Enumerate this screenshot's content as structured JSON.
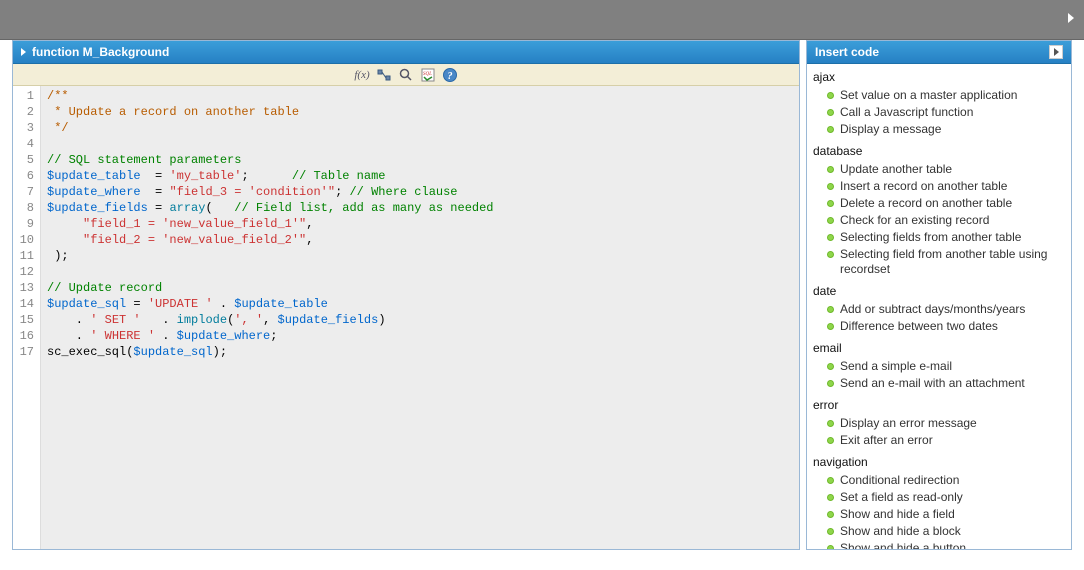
{
  "left_header": {
    "title": "function M_Background"
  },
  "right_header": {
    "title": "Insert code"
  },
  "toolbar_icons": [
    "fx-icon",
    "match-brackets-icon",
    "search-icon",
    "sql-icon",
    "help-icon"
  ],
  "code": {
    "lines": [
      [
        [
          "doccomment",
          "/**"
        ]
      ],
      [
        [
          "doccomment",
          " * Update a record on another table"
        ]
      ],
      [
        [
          "doccomment",
          " */"
        ]
      ],
      [],
      [
        [
          "comment",
          "// SQL statement parameters"
        ]
      ],
      [
        [
          "var",
          "$update_table"
        ],
        [
          "plain",
          "  = "
        ],
        [
          "str",
          "'my_table'"
        ],
        [
          "plain",
          ";      "
        ],
        [
          "comment",
          "// Table name"
        ]
      ],
      [
        [
          "var",
          "$update_where"
        ],
        [
          "plain",
          "  = "
        ],
        [
          "str",
          "\"field_3 = 'condition'\""
        ],
        [
          "plain",
          "; "
        ],
        [
          "comment",
          "// Where clause"
        ]
      ],
      [
        [
          "var",
          "$update_fields"
        ],
        [
          "plain",
          " = "
        ],
        [
          "kw",
          "array"
        ],
        [
          "plain",
          "(   "
        ],
        [
          "comment",
          "// Field list, add as many as needed"
        ]
      ],
      [
        [
          "plain",
          "     "
        ],
        [
          "str",
          "\"field_1 = 'new_value_field_1'\""
        ],
        [
          "plain",
          ","
        ]
      ],
      [
        [
          "plain",
          "     "
        ],
        [
          "str",
          "\"field_2 = 'new_value_field_2'\""
        ],
        [
          "plain",
          ","
        ]
      ],
      [
        [
          "plain",
          " );"
        ]
      ],
      [],
      [
        [
          "comment",
          "// Update record"
        ]
      ],
      [
        [
          "var",
          "$update_sql"
        ],
        [
          "plain",
          " = "
        ],
        [
          "str",
          "'UPDATE '"
        ],
        [
          "plain",
          " . "
        ],
        [
          "var",
          "$update_table"
        ]
      ],
      [
        [
          "plain",
          "    . "
        ],
        [
          "str",
          "' SET '"
        ],
        [
          "plain",
          "   . "
        ],
        [
          "kw",
          "implode"
        ],
        [
          "plain",
          "("
        ],
        [
          "str",
          "', '"
        ],
        [
          "plain",
          ", "
        ],
        [
          "var",
          "$update_fields"
        ],
        [
          "plain",
          ")"
        ]
      ],
      [
        [
          "plain",
          "    . "
        ],
        [
          "str",
          "' WHERE '"
        ],
        [
          "plain",
          " . "
        ],
        [
          "var",
          "$update_where"
        ],
        [
          "plain",
          ";"
        ]
      ],
      [
        [
          "plain",
          "sc_exec_sql("
        ],
        [
          "var",
          "$update_sql"
        ],
        [
          "plain",
          ");"
        ]
      ]
    ]
  },
  "snippets": [
    {
      "category": "ajax",
      "items": [
        "Set value on a master application",
        "Call a Javascript function",
        "Display a message"
      ]
    },
    {
      "category": "database",
      "items": [
        "Update another table",
        "Insert a record on another table",
        "Delete a record on another table",
        "Check for an existing record",
        "Selecting fields from another table",
        "Selecting field from another table using recordset"
      ]
    },
    {
      "category": "date",
      "items": [
        "Add or subtract days/months/years",
        "Difference between two dates"
      ]
    },
    {
      "category": "email",
      "items": [
        "Send a simple e-mail",
        "Send an e-mail with an attachment"
      ]
    },
    {
      "category": "error",
      "items": [
        "Display an error message",
        "Exit after an error"
      ]
    },
    {
      "category": "navigation",
      "items": [
        "Conditional redirection",
        "Set a field as read-only",
        "Show and hide a field",
        "Show and hide a block",
        "Show and hide a button"
      ]
    }
  ]
}
